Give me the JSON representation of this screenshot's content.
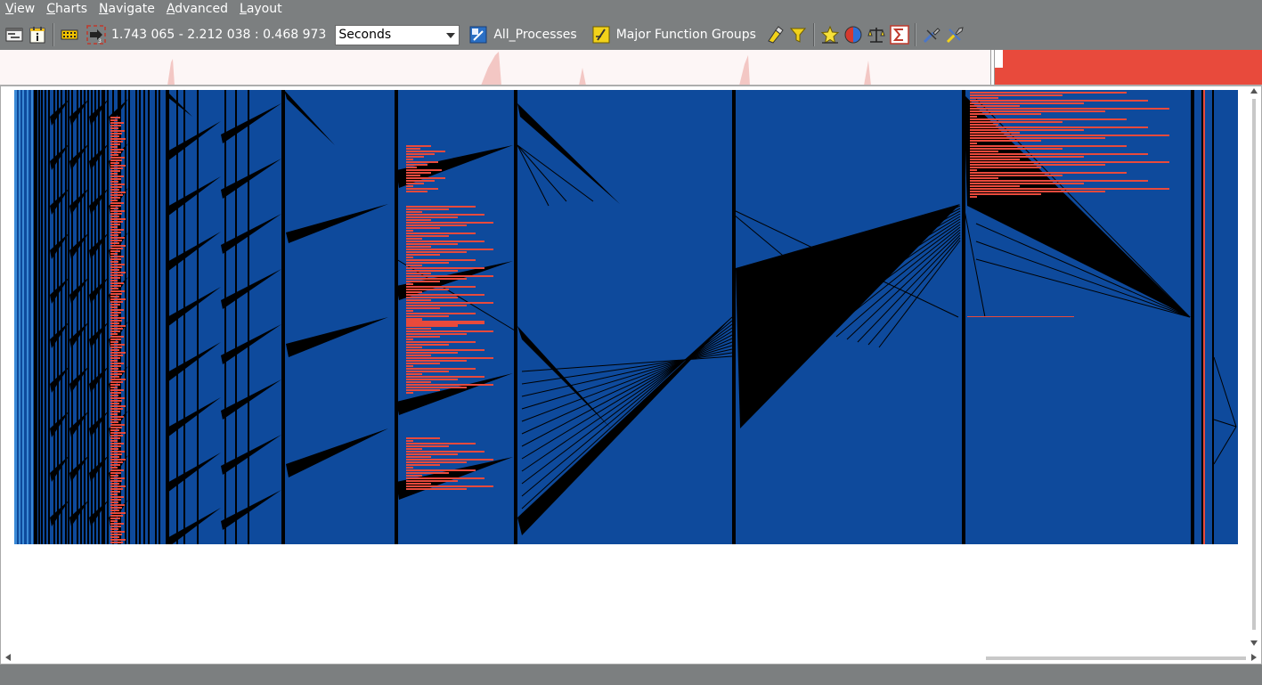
{
  "menu": [
    {
      "label": "View",
      "accel": "V",
      "rest": "iew"
    },
    {
      "label": "Charts",
      "accel": "C",
      "rest": "harts"
    },
    {
      "label": "Navigate",
      "accel": "N",
      "rest": "avigate"
    },
    {
      "label": "Advanced",
      "accel": "A",
      "rest": "dvanced"
    },
    {
      "label": "Layout",
      "accel": "L",
      "rest": "ayout"
    }
  ],
  "toolbar": {
    "time_range": "1.743 065 - 2.212 038 : 0.468 973",
    "time_unit": "Seconds",
    "process_filter_label": "All_Processes",
    "function_groups_label": "Major Function Groups"
  },
  "icons": {
    "timeline": "timeline-icon",
    "info": "info-icon",
    "film": "film-icon",
    "zoom_selection": "zoom-selection-icon",
    "process_filter": "process-filter-icon",
    "function_groups": "function-groups-icon",
    "highlight": "highlight-icon",
    "filter": "filter-icon",
    "star": "star-icon",
    "color_sphere": "color-sphere-icon",
    "balance": "balance-icon",
    "sigma": "sigma-icon",
    "tools_a": "tools-icon",
    "tools_b": "wrench-icon"
  },
  "colors": {
    "chart_background": "#0e4a9c",
    "message_lines": "#000000",
    "highlight_function": "#e84a3c",
    "process_lane": "#3a8ad6",
    "overview_red": "#e84a3c"
  }
}
